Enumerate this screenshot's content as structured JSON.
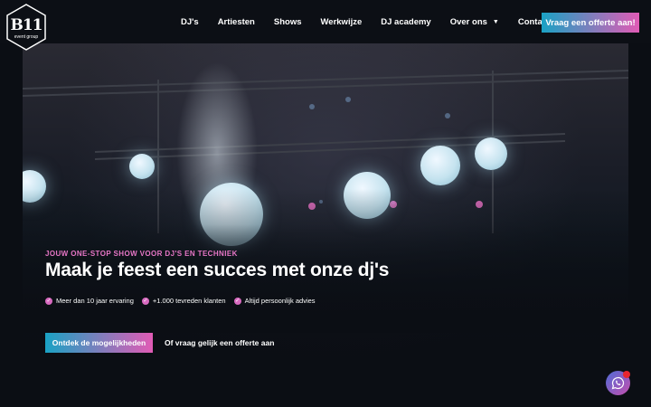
{
  "brand": {
    "logo_text": "B11",
    "logo_subtext": "event group"
  },
  "nav": {
    "items": [
      {
        "label": "DJ's",
        "dropdown": false
      },
      {
        "label": "Artiesten",
        "dropdown": false
      },
      {
        "label": "Shows",
        "dropdown": false
      },
      {
        "label": "Werkwijze",
        "dropdown": false
      },
      {
        "label": "DJ academy",
        "dropdown": false
      },
      {
        "label": "Over ons",
        "dropdown": true
      },
      {
        "label": "Contact",
        "dropdown": false
      }
    ],
    "cta_label": "Vraag een offerte aan!"
  },
  "hero": {
    "eyebrow": "JOUW ONE-STOP SHOW VOOR DJ'S EN TECHNIEK",
    "headline": "Maak je feest een succes met onze dj's",
    "usps": [
      "Meer dan 10 jaar ervaring",
      "+1.000 tevreden klanten",
      "Altijd persoonlijk advies"
    ],
    "primary_cta": "Ontdek de mogelijkheden",
    "secondary_cta": "Of vraag gelijk een offerte aan"
  },
  "colors": {
    "accent_blue": "#1aa2c4",
    "accent_pink": "#e15bb5",
    "background": "#0b0e14",
    "notification": "#e8252f"
  },
  "icons": {
    "check": "check-circle-icon",
    "dropdown": "chevron-down-icon",
    "chat": "whatsapp-icon"
  }
}
